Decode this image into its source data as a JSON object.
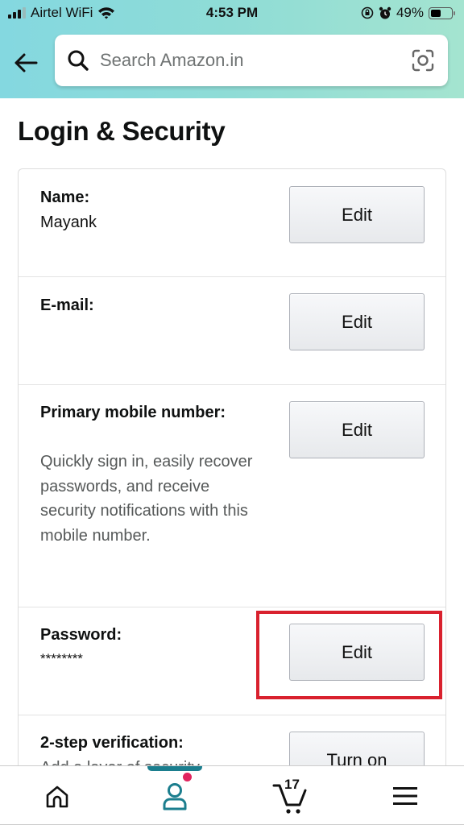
{
  "status_bar": {
    "carrier": "Airtel WiFi",
    "time": "4:53 PM",
    "battery": "49%",
    "battery_level": 0.49
  },
  "header": {
    "back_icon": "arrow-left-icon",
    "search_placeholder": "Search Amazon.in",
    "search_value": "",
    "search_icon": "magnifier-icon",
    "camera_icon": "camera-scan-icon"
  },
  "page": {
    "title": "Login & Security"
  },
  "sections": [
    {
      "label": "Name:",
      "value": "Mayank",
      "button": "Edit"
    },
    {
      "label": "E-mail:",
      "value": "",
      "button": "Edit"
    },
    {
      "label": "Primary mobile number:",
      "value": "",
      "description": "Quickly sign in, easily recover passwords, and receive security notifications with this mobile number.",
      "button": "Edit"
    },
    {
      "label": "Password:",
      "value": "********",
      "button": "Edit",
      "highlighted": true
    },
    {
      "label": "2-step verification:",
      "description": "Add a layer of security",
      "button": "Turn on"
    }
  ],
  "bottom_nav": {
    "items": [
      {
        "name": "home",
        "icon": "home-icon"
      },
      {
        "name": "account",
        "icon": "user-icon",
        "active": true,
        "notification_dot": true
      },
      {
        "name": "cart",
        "icon": "cart-icon",
        "count": "17"
      },
      {
        "name": "menu",
        "icon": "hamburger-icon"
      }
    ]
  },
  "colors": {
    "header_gradient_start": "#84d8e0",
    "header_gradient_end": "#a4e4d0",
    "active_accent": "#1b7e8e",
    "highlight_box": "#d9212e",
    "notification_dot": "#e0245e"
  }
}
